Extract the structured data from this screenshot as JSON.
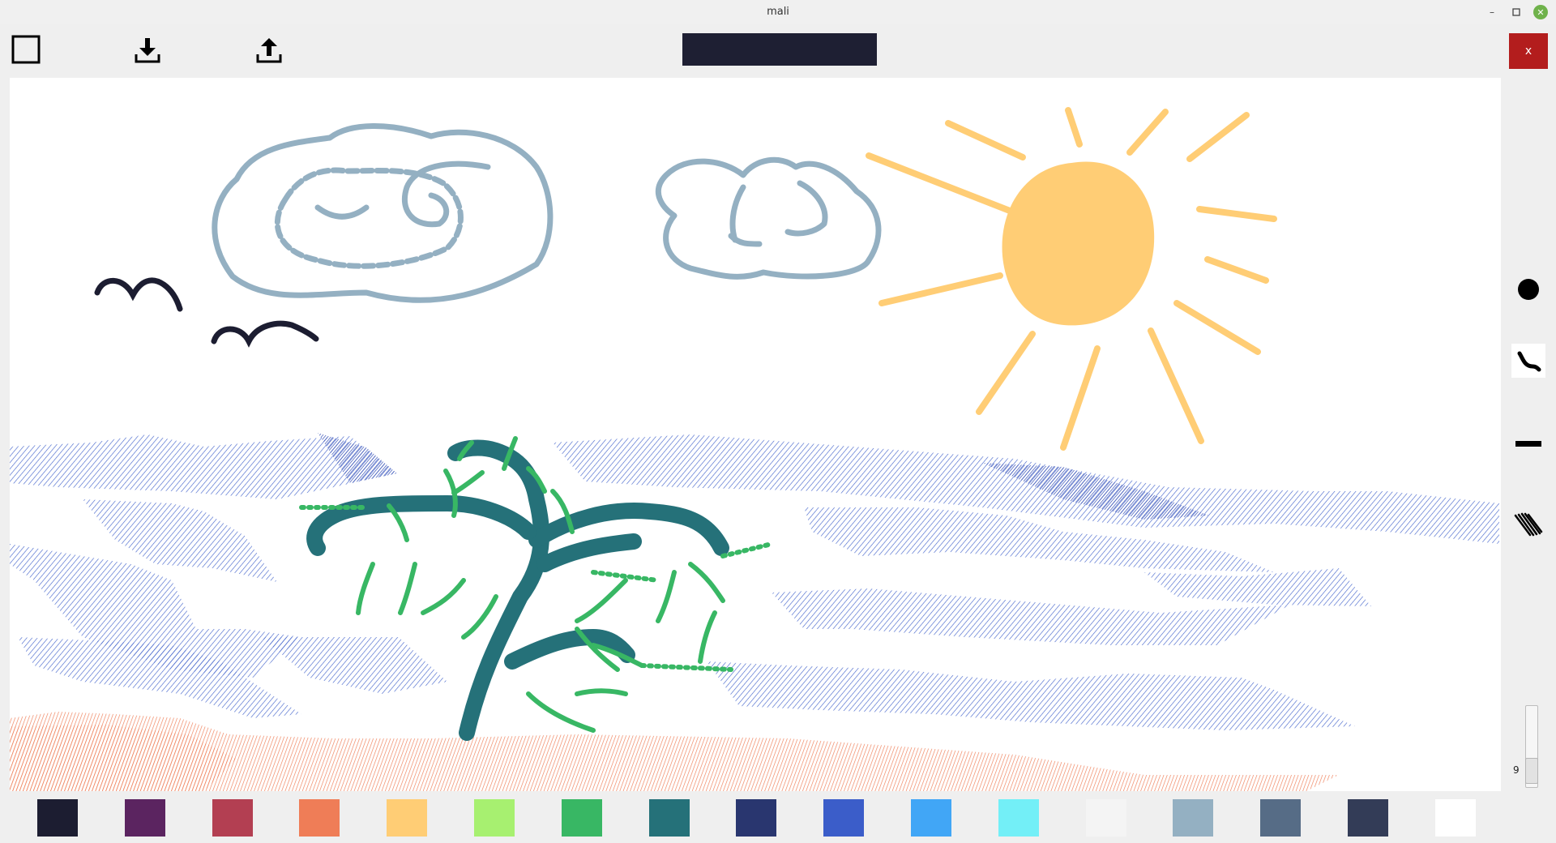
{
  "window": {
    "title": "mali"
  },
  "toolbar": {
    "close_label": "x",
    "current_color": "#1e1f33"
  },
  "brush_size": {
    "value": "9"
  },
  "palette": [
    "#1c1d31",
    "#5b2460",
    "#b33f52",
    "#ef7d57",
    "#ffcd75",
    "#a7f070",
    "#38b764",
    "#257179",
    "#29366f",
    "#3b5dc9",
    "#41a6f6",
    "#73eff7",
    "#f4f4f4",
    "#94b0c2",
    "#566c86",
    "#333c57",
    "#ffffff"
  ],
  "drawing_colors": {
    "sky_clouds": "#94b0c2",
    "sun": "#ffcd75",
    "birds": "#1c1d31",
    "water": "#3b5dc9",
    "tree_trunk": "#257179",
    "tree_leaves": "#38b764",
    "ground": "#ef7d57"
  }
}
